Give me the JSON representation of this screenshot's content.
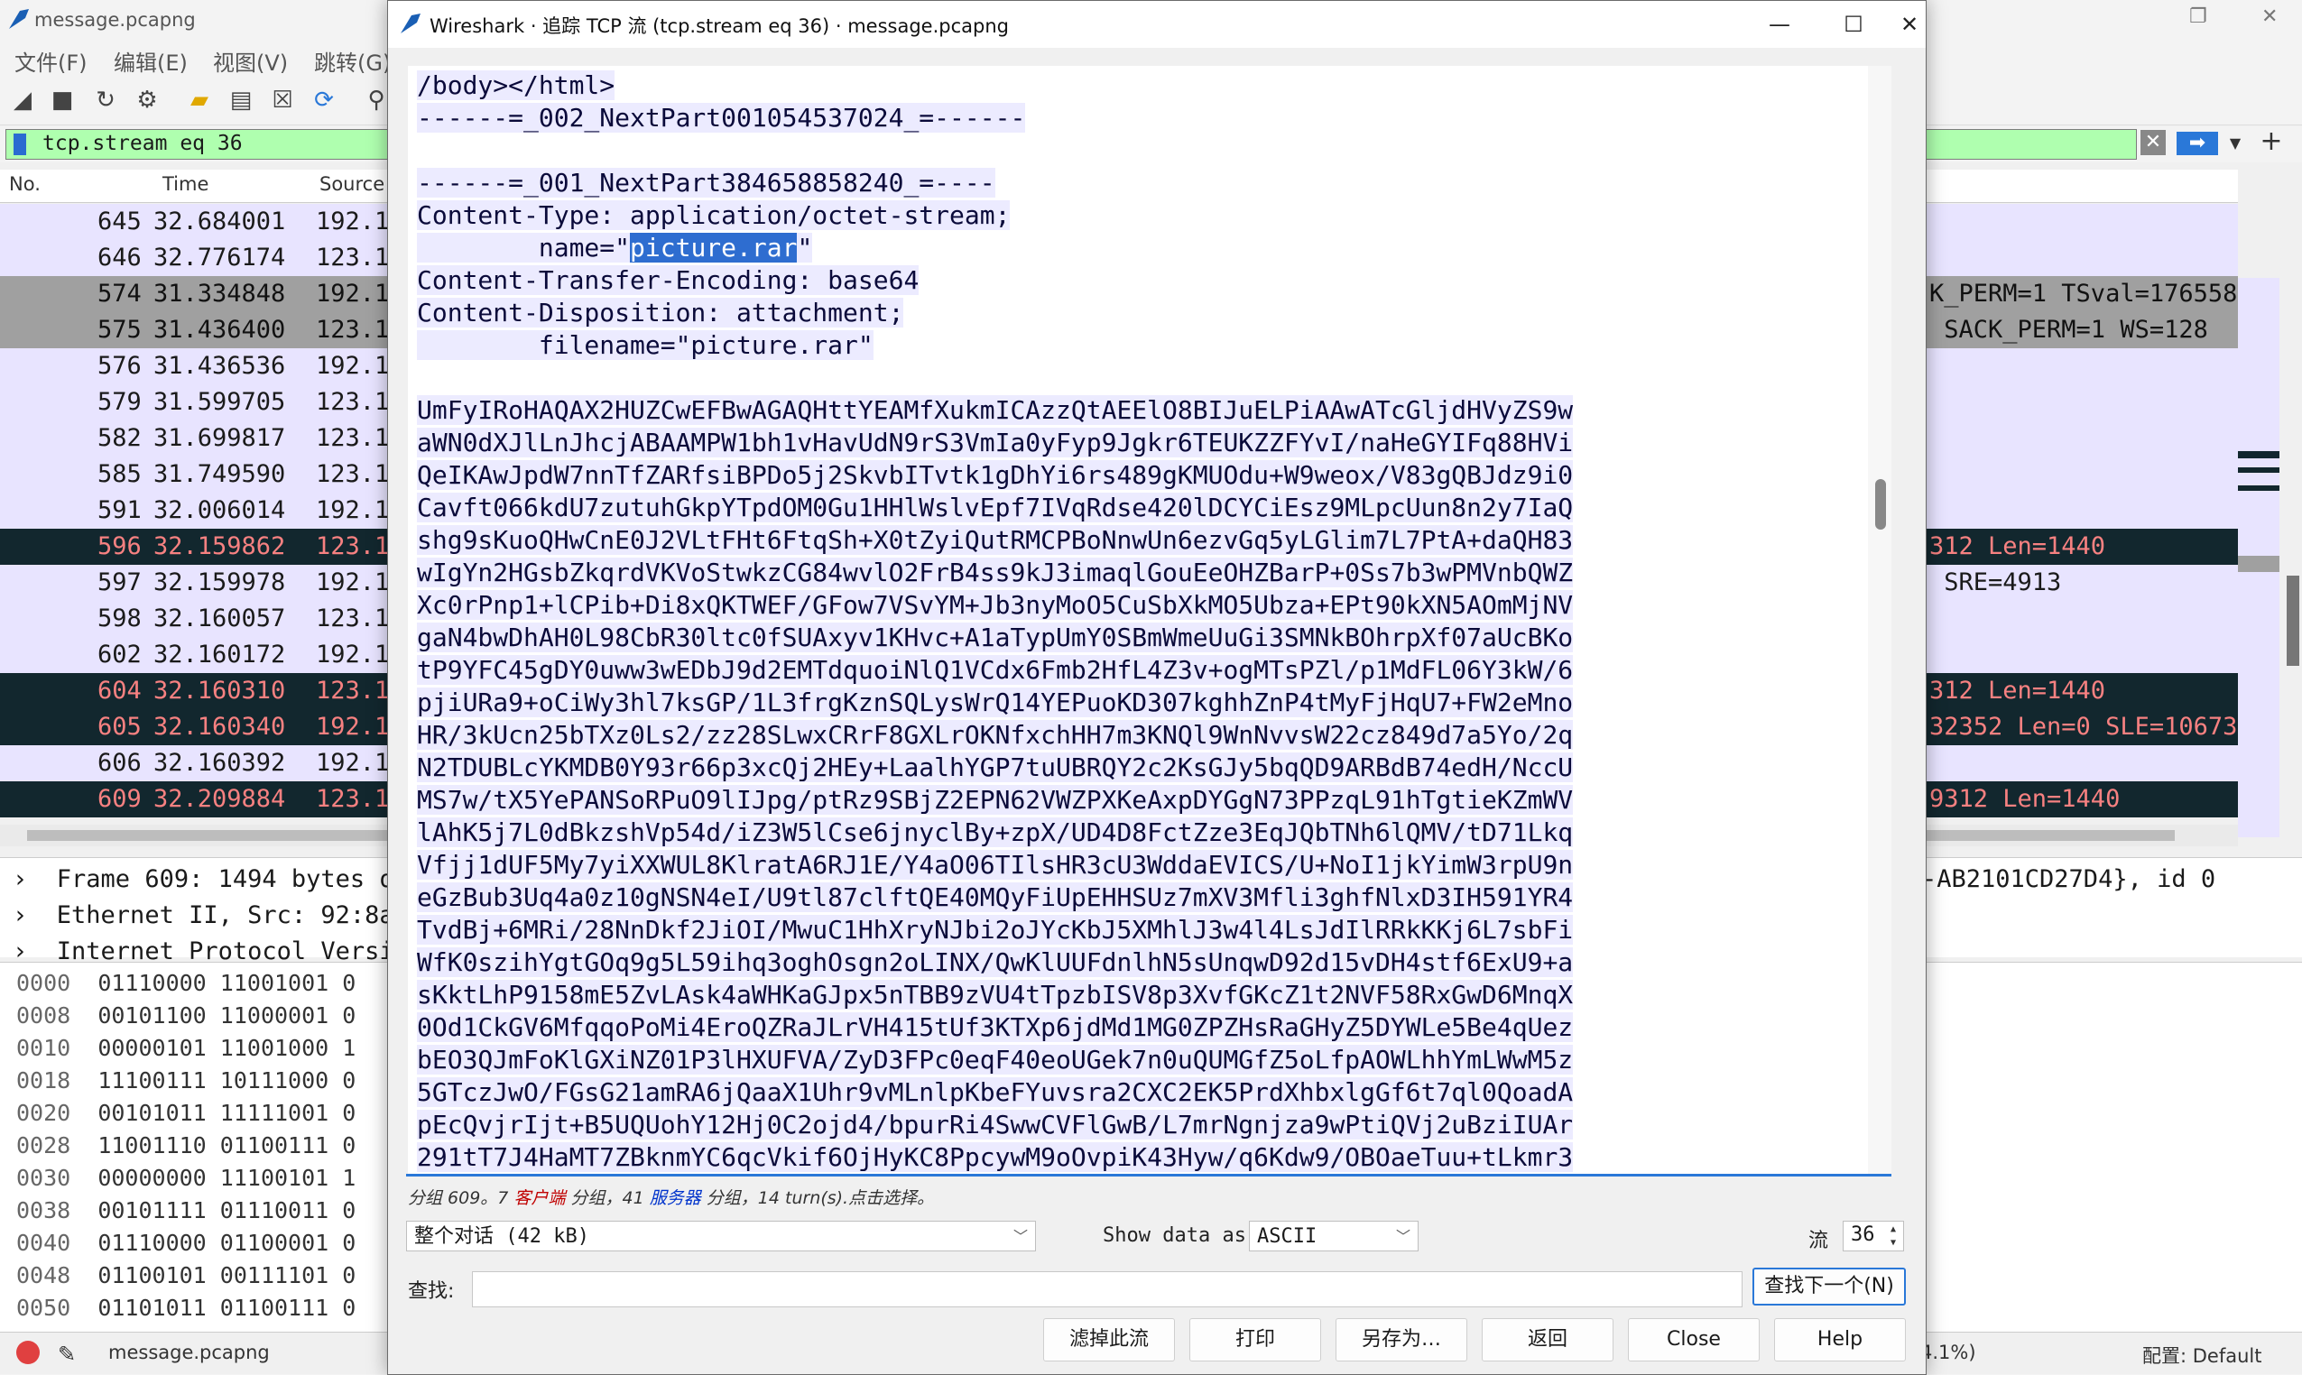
{
  "main": {
    "title": "message.pcapng",
    "menu": [
      "文件(F)",
      "编辑(E)",
      "视图(V)",
      "跳转(G)"
    ],
    "filter": "tcp.stream eq 36",
    "columns": {
      "no": "No.",
      "time": "Time",
      "source": "Source"
    },
    "packets": [
      {
        "no": "645",
        "time": "32.684001",
        "src": "192.1",
        "info": "",
        "style": "lav"
      },
      {
        "no": "646",
        "time": "32.776174",
        "src": "123.1",
        "info": "",
        "style": "lav"
      },
      {
        "no": "574",
        "time": "31.334848",
        "src": "192.1",
        "info": "K_PERM=1 TSval=176558",
        "style": "grey"
      },
      {
        "no": "575",
        "time": "31.436400",
        "src": "123.1",
        "info": " SACK_PERM=1 WS=128",
        "style": "grey"
      },
      {
        "no": "576",
        "time": "31.436536",
        "src": "192.1",
        "info": "",
        "style": "lav"
      },
      {
        "no": "579",
        "time": "31.599705",
        "src": "123.1",
        "info": "",
        "style": "lav"
      },
      {
        "no": "582",
        "time": "31.699817",
        "src": "123.1",
        "info": "",
        "style": "lav"
      },
      {
        "no": "585",
        "time": "31.749590",
        "src": "123.1",
        "info": "",
        "style": "lav"
      },
      {
        "no": "591",
        "time": "32.006014",
        "src": "192.1",
        "info": "",
        "style": "lav"
      },
      {
        "no": "596",
        "time": "32.159862",
        "src": "123.1",
        "info": "312 Len=1440",
        "style": "dark"
      },
      {
        "no": "597",
        "time": "32.159978",
        "src": "192.1",
        "info": " SRE=4913",
        "style": "lav"
      },
      {
        "no": "598",
        "time": "32.160057",
        "src": "123.1",
        "info": "",
        "style": "lav"
      },
      {
        "no": "602",
        "time": "32.160172",
        "src": "192.1",
        "info": "",
        "style": "lav"
      },
      {
        "no": "604",
        "time": "32.160310",
        "src": "123.1",
        "info": "312 Len=1440",
        "style": "dark"
      },
      {
        "no": "605",
        "time": "32.160340",
        "src": "192.1",
        "info": "32352 Len=0 SLE=10673",
        "style": "dark"
      },
      {
        "no": "606",
        "time": "32.160392",
        "src": "192.1",
        "info": "",
        "style": "lav"
      },
      {
        "no": "609",
        "time": "32.209884",
        "src": "123.1",
        "info": "9312 Len=1440",
        "style": "dark"
      }
    ],
    "details": [
      {
        "text": "Frame 609: 1494 bytes o",
        "right": "-AB2101CD27D4}, id 0"
      },
      {
        "text": "Ethernet II, Src: 92:8a",
        "right": ""
      },
      {
        "text": "Internet Protocol Versi",
        "right": ""
      }
    ],
    "bytes": [
      {
        "off": "0000",
        "b": "01110000 11001001 0"
      },
      {
        "off": "0008",
        "b": "00101100 11000001 0"
      },
      {
        "off": "0010",
        "b": "00000101 11001000 1"
      },
      {
        "off": "0018",
        "b": "11100111 10111000 0"
      },
      {
        "off": "0020",
        "b": "00101011 11111001 0"
      },
      {
        "off": "0028",
        "b": "11001110 01100111 0"
      },
      {
        "off": "0030",
        "b": "00000000 11100101 1"
      },
      {
        "off": "0038",
        "b": "00101111 01110011 0"
      },
      {
        "off": "0040",
        "b": "01110000 01100001 0"
      },
      {
        "off": "0048",
        "b": "01100101 00111101 0"
      },
      {
        "off": "0050",
        "b": "01101011 01100111 0"
      }
    ],
    "status": {
      "file": "message.pcapng",
      "pct": "4.1%)",
      "profile": "配置: Default"
    }
  },
  "dialog": {
    "title": "Wireshark · 追踪 TCP 流 (tcp.stream eq 36) · message.pcapng",
    "stream_header": [
      {
        "t": "/body></html>",
        "hl": true
      },
      {
        "t": "------=_002_NextPart001054537024_=------",
        "hl": true
      },
      {
        "t": "",
        "hl": false
      },
      {
        "t": "------=_001_NextPart384658858240_=----",
        "hl": true
      },
      {
        "t": "Content-Type: application/octet-stream;",
        "hl": true
      },
      {
        "t": "        name=\"",
        "hl": true,
        "sel": "picture.rar",
        "after": "\""
      },
      {
        "t": "Content-Transfer-Encoding: base64",
        "hl": true
      },
      {
        "t": "Content-Disposition: attachment;",
        "hl": true
      },
      {
        "t": "        filename=\"picture.rar\"",
        "hl": true
      },
      {
        "t": "",
        "hl": false
      }
    ],
    "base64_lines": [
      "UmFyIRoHAQAX2HUZCwEFBwAGAQHttYEAMfXukmICAzzQtAEElO8BIJuELPiAAwATcGljdHVyZS9w",
      "aWN0dXJlLnJhcjABAAMPW1bh1vHavUdN9rS3VmIa0yFyp9Jgkr6TEUKZZFYvI/naHeGYIFq88HVi",
      "QeIKAwJpdW7nnTfZARfsiBPDo5j2SkvbITvtk1gDhYi6rs489gKMUOdu+W9weox/V83gQBJdz9i0",
      "Cavft066kdU7zutuhGkpYTpdOM0Gu1HHlWslvEpf7IVqRdse420lDCYCiEsz9MLpcUun8n2y7IaQ",
      "shg9sKuoQHwCnE0J2VLtFHt6FtqSh+X0tZyiQutRMCPBoNnwUn6ezvGq5yLGlim7L7PtA+daQH83",
      "wIgYn2HGsbZkqrdVKVoStwkzCG84wvlO2FrB4ss9kJ3imaqlGouEeOHZBarP+0Ss7b3wPMVnbQWZ",
      "Xc0rPnp1+lCPib+Di8xQKTWEF/GFow7VSvYM+Jb3nyMoO5CuSbXkMO5Ubza+EPt90kXN5AOmMjNV",
      "gaN4bwDhAH0L98CbR30ltc0fSUAxyv1KHvc+A1aTypUmY0SBmWmeUuGi3SMNkBOhrpXf07aUcBKo",
      "tP9YFC45gDY0uww3wEDbJ9d2EMTdquoiNlQ1VCdx6Fmb2HfL4Z3v+ogMTsPZl/p1MdFL06Y3kW/6",
      "pjiURa9+oCiWy3hl7ksGP/1L3frgKznSQLysWrQ14YEPuoKD307kghhZnP4tMyFjHqU7+FW2eMno",
      "HR/3kUcn25bTXz0Ls2/zz28SLwxCRrF8GXLrOKNfxchHH7m3KNQl9WnNvvsW22cz849d7a5Yo/2q",
      "N2TDUBLcYKMDB0Y93r66p3xcQj2HEy+LaalhYGP7tuUBRQY2c2KsGJy5bqQD9ARBdB74edH/NccU",
      "MS7w/tX5YePANSoRPuO9lIJpg/ptRz9SBjZ2EPN62VWZPXKeAxpDYGgN73PPzqL91hTgtieKZmWV",
      "lAhK5j7L0dBkzshVp54d/iZ3W5lCse6jnyclBy+zpX/UD4D8FctZze3EqJQbTNh6lQMV/tD71Lkq",
      "Vfjj1dUF5My7yiXXWUL8KlratA6RJ1E/Y4aO06TIlsHR3cU3WddaEVICS/U+NoI1jkYimW3rpU9n",
      "eGzBub3Uq4a0z10gNSN4eI/U9tl87clftQE40MQyFiUpEHHSUz7mXV3Mfli3ghfNlxD3IH591YR4",
      "TvdBj+6MRi/28NnDkf2JiOI/MwuC1HhXryNJbi2oJYcKbJ5XMhlJ3w4l4LsJdIlRRkKKj6L7sbFi",
      "WfK0szihYgtGOq9g5L59ihq3oghOsgn2oLINX/QwKlUUFdnlhN5sUnqwD92d15vDH4stf6ExU9+a",
      "sKktLhP9158mE5ZvLAsk4aWHKaGJpx5nTBB9zVU4tTpzbISV8p3XvfGKcZ1t2NVF58RxGwD6MnqX",
      "0Od1CkGV6MfqqoPoMi4EroQZRaJLrVH415tUf3KTXp6jdMd1MG0ZPZHsRaGHyZ5DYWLe5Be4qUez",
      "bEO3QJmFoKlGXiNZ01P3lHXUFVA/ZyD3FPc0eqF40eoUGek7n0uQUMGfZ5oLfpAOWLhhYmLWwM5z",
      "5GTczJwO/FGsG21amRA6jQaaX1Uhr9vMLnlpKbeFYuvsra2CXC2EK5PrdXhbxlgGf6t7ql0QoadA",
      "pEcQvjrIjt+B5UQUohY12Hj0C2ojd4/bpurRi4SwwCVFlGwB/L7mrNgnjza9wPtiQVj2uBziIUAr",
      "291tT7J4HaMT7ZBknmYC6qcVkif6OjHyKC8PpcywM9oOvpiK43Hyw/q6Kdw9/OBOaeTuu+tLkmr3"
    ],
    "summary": {
      "p1": "分组 609。7 ",
      "client": "客户端",
      "p2": " 分组，41 ",
      "server": "服务器",
      "p3": " 分组，14 turn(s).点击选择。"
    },
    "conversation": "整个对话 (42 kB)",
    "show_data_as_label": "Show data as",
    "show_data_as": "ASCII",
    "stream_label": "流",
    "stream_no": "36",
    "find_label": "查找:",
    "find_value": "",
    "find_next": "查找下一个(N)",
    "buttons": {
      "filter_out": "滤掉此流",
      "print": "打印",
      "save_as": "另存为…",
      "back": "返回",
      "close": "Close",
      "help": "Help"
    }
  }
}
